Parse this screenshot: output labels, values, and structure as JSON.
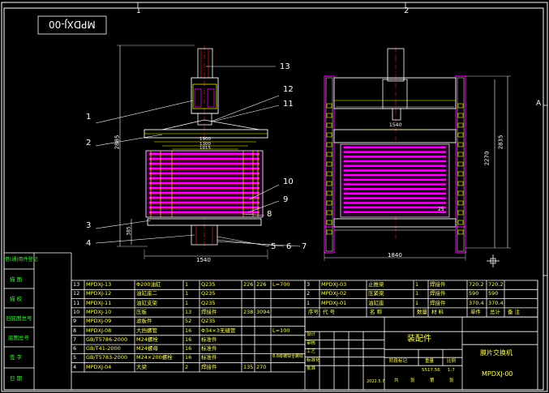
{
  "drawing": {
    "title_stamp": "MPDXJ-00",
    "zone_numbers": [
      "1",
      "2"
    ],
    "edge_letter": "A",
    "callouts": [
      "1",
      "2",
      "3",
      "4",
      "5",
      "6",
      "7",
      "8",
      "9",
      "10",
      "11",
      "12",
      "13"
    ],
    "dimensions": {
      "front_width": "1540",
      "front_height": "2885",
      "front_small": "385",
      "inner_1900": "1900",
      "inner_1300": "1300",
      "inner_1015": "1015",
      "side_width": "1840",
      "side_2270": "2270",
      "side_2835": "2835",
      "side_1540": "1540",
      "side_25": "25"
    }
  },
  "left_labels": [
    "借(通)用件登记",
    "描 图",
    "描 校",
    "旧底图总号",
    "底图总号",
    "签 字",
    "日 期"
  ],
  "bom_left": [
    {
      "no": "13",
      "code": "MPDXJ-13",
      "name": "Φ200油缸",
      "qty": "1",
      "mat": "Q235",
      "w1": "226",
      "w2": "226",
      "note": "L=700"
    },
    {
      "no": "12",
      "code": "MPDXJ-12",
      "name": "油缸座二",
      "qty": "1",
      "mat": "Q235",
      "w1": "",
      "w2": "",
      "note": ""
    },
    {
      "no": "11",
      "code": "MPDXJ-11",
      "name": "油缸支架",
      "qty": "1",
      "mat": "Q235",
      "w1": "",
      "w2": "",
      "note": ""
    },
    {
      "no": "10",
      "code": "MPDXJ-10",
      "name": "压板",
      "qty": "13",
      "mat": "焊接件",
      "w1": "238",
      "w2": "3094",
      "note": ""
    },
    {
      "no": "9",
      "code": "MPDXJ-09",
      "name": "滤板件",
      "qty": "52",
      "mat": "Q235",
      "w1": "",
      "w2": "",
      "note": ""
    },
    {
      "no": "8",
      "code": "MPDXJ-08",
      "name": "大挡螺管",
      "qty": "16",
      "mat": "Φ34×3无缝管",
      "w1": "",
      "w2": "",
      "note": "L=100"
    },
    {
      "no": "7",
      "code": "GB/T5786-2000",
      "name": "M24螺栓",
      "qty": "16",
      "mat": "标准件",
      "w1": "",
      "w2": "",
      "note": ""
    },
    {
      "no": "6",
      "code": "GB/T41-2000",
      "name": "M24螺母",
      "qty": "16",
      "mat": "标准件",
      "w1": "",
      "w2": "",
      "note": ""
    },
    {
      "no": "5",
      "code": "GB/T5783-2000",
      "name": "M24×200螺栓",
      "qty": "16",
      "mat": "标准件",
      "w1": "",
      "w2": "",
      "note": "8.8级镀锌全螺纹"
    },
    {
      "no": "4",
      "code": "MPDXJ-04",
      "name": "大梁",
      "qty": "2",
      "mat": "焊接件",
      "w1": "135",
      "w2": "270",
      "note": ""
    }
  ],
  "bom_right": [
    {
      "no": "3",
      "code": "MPDXJ-03",
      "name": "止推梁",
      "qty": "1",
      "mat": "焊接件",
      "w1": "720.2",
      "w2": "720.2"
    },
    {
      "no": "2",
      "code": "MPDXJ-02",
      "name": "压紧梁",
      "qty": "1",
      "mat": "焊接件",
      "w1": "590",
      "w2": "590"
    },
    {
      "no": "1",
      "code": "MPDXJ-01",
      "name": "油缸座",
      "qty": "1",
      "mat": "焊接件",
      "w1": "370.4",
      "w2": "370.4"
    }
  ],
  "bom_right_header": [
    "序号",
    "代 号",
    "名 称",
    "数量",
    "材 料",
    "单件",
    "总计",
    "备 注"
  ],
  "title_block": {
    "assembly": "装配件",
    "machine": "膜片交换机",
    "drawing_no": "MPDXJ-00",
    "sign_row": [
      "设计",
      "审核",
      "工艺",
      "标准化",
      "批准"
    ],
    "stage": "阶段标记",
    "weight_label": "重量",
    "scale_label": "比例",
    "weight": "5517.56",
    "scale": "1:7",
    "sheet_a": "共",
    "sheet_b": "张",
    "sheet_c": "第",
    "sheet_d": "张",
    "date": "2022.5.7"
  },
  "colors": {
    "frame": "#ffffff",
    "outline": "#ffffff",
    "magenta": "#ff00ff",
    "yellow": "#ffff00",
    "green": "#00ff00",
    "red": "#ff2020",
    "cyan": "#00ffff"
  }
}
